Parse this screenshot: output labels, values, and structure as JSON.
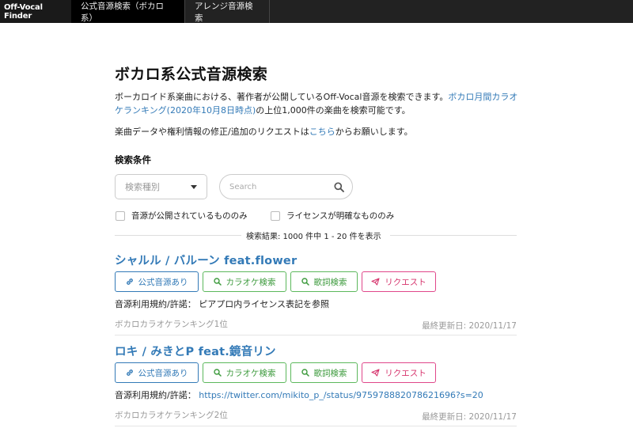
{
  "nav": {
    "brand": "Off-Vocal Finder",
    "items": [
      {
        "label": "公式音源検索（ボカロ系）"
      },
      {
        "label": "アレンジ音源検索"
      }
    ]
  },
  "page": {
    "title": "ボカロ系公式音源検索",
    "desc_prefix": "ボーカロイド系楽曲における、著作者が公開しているOff-Vocal音源を検索できます。",
    "desc_link": "ボカロ月間カラオケランキング(2020年10月8日時点)",
    "desc_suffix": "の上位1,000件の楽曲を検索可能です。",
    "req_prefix": "楽曲データや権利情報の修正/追加のリクエストは",
    "req_link": "こちら",
    "req_suffix": "からお願いします。"
  },
  "search": {
    "section_label": "検索条件",
    "type_placeholder": "検索種別",
    "placeholder": "Search",
    "check_public": "音源が公開されているもののみ",
    "check_license": "ライセンスが明確なもののみ",
    "result_count": "検索結果: 1000 件中 1 - 20 件を表示"
  },
  "buttons": {
    "official": "公式音源あり",
    "karaoke": "カラオケ検索",
    "lyrics": "歌詞検索",
    "request": "リクエスト"
  },
  "songs": [
    {
      "title": "シャルル / バルーン feat.flower",
      "license_label": "音源利用規約/許諾：",
      "license_value": "ピアプロ内ライセンス表記を参照",
      "license_is_link": false,
      "rank": "ボカロカラオケランキング1位",
      "updated": "最終更新日: 2020/11/17"
    },
    {
      "title": "ロキ / みきとP feat.鏡音リン",
      "license_label": "音源利用規約/許諾：",
      "license_value": "https://twitter.com/mikito_p_/status/975978882078621696?s=20",
      "license_is_link": true,
      "rank": "ボカロカラオケランキング2位",
      "updated": "最終更新日: 2020/11/17"
    }
  ],
  "colors": {
    "navbar": "#222222",
    "link": "#337ab7",
    "green": "#5cb85c",
    "pink": "#e0478a"
  }
}
